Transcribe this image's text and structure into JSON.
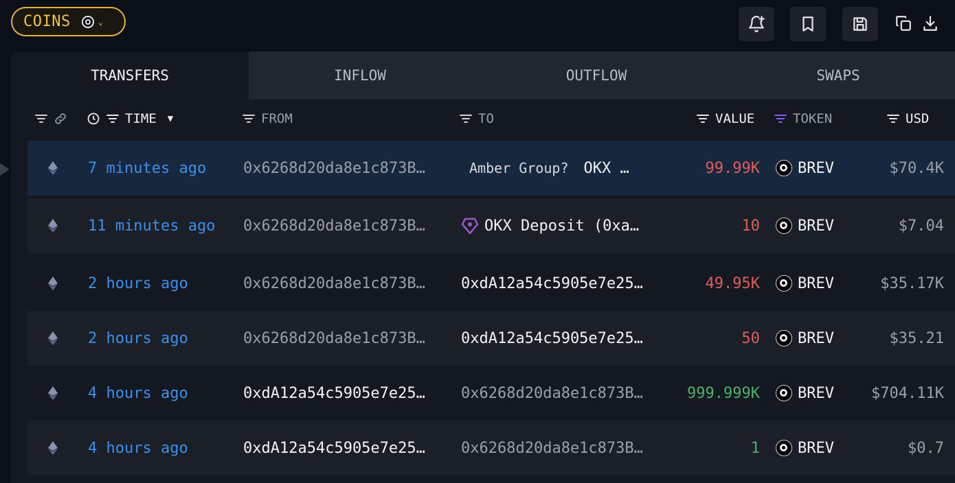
{
  "toolbar": {
    "coins_label": "COINS",
    "coins_token_icon": "token-icon",
    "buttons": [
      {
        "name": "add-alert-button",
        "icon": "bell-plus-icon"
      },
      {
        "name": "bookmark-button",
        "icon": "bookmark-icon"
      },
      {
        "name": "save-button",
        "icon": "save-icon"
      },
      {
        "name": "copy-button",
        "icon": "copy-icon"
      },
      {
        "name": "download-button",
        "icon": "download-icon"
      }
    ]
  },
  "tabs": [
    {
      "label": "TRANSFERS",
      "active": true
    },
    {
      "label": "INFLOW",
      "active": false
    },
    {
      "label": "OUTFLOW",
      "active": false
    },
    {
      "label": "SWAPS",
      "active": false
    }
  ],
  "columns": {
    "time": "TIME",
    "from": "FROM",
    "to": "TO",
    "value": "VALUE",
    "token": "TOKEN",
    "usd": "USD"
  },
  "rows": [
    {
      "chain": "ethereum-icon",
      "time": "7 minutes ago",
      "from": "0x6268d20da8e1c873B…",
      "to_entity_small": "Amber Group?",
      "to": "OKX …",
      "value": "99.99K",
      "direction": "out",
      "token": "BREV",
      "usd": "$70.4K",
      "selected": true
    },
    {
      "chain": "ethereum-icon",
      "time": "11 minutes ago",
      "from": "0x6268d20da8e1c873B…",
      "to_icon": "okx-icon",
      "to": "OKX Deposit (0xa…",
      "value": "10",
      "direction": "out",
      "token": "BREV",
      "usd": "$7.04"
    },
    {
      "chain": "ethereum-icon",
      "time": "2 hours ago",
      "from": "0x6268d20da8e1c873B…",
      "to": "0xdA12a54c5905e7e25…",
      "value": "49.95K",
      "direction": "out",
      "token": "BREV",
      "usd": "$35.17K"
    },
    {
      "chain": "ethereum-icon",
      "time": "2 hours ago",
      "from": "0x6268d20da8e1c873B…",
      "to": "0xdA12a54c5905e7e25…",
      "value": "50",
      "direction": "out",
      "token": "BREV",
      "usd": "$35.21"
    },
    {
      "chain": "ethereum-icon",
      "time": "4 hours ago",
      "from": "0xdA12a54c5905e7e25…",
      "to": "0x6268d20da8e1c873B…",
      "value": "999.999K",
      "direction": "in",
      "token": "BREV",
      "usd": "$704.11K"
    },
    {
      "chain": "ethereum-icon",
      "time": "4 hours ago",
      "from": "0xdA12a54c5905e7e25…",
      "to": "0x6268d20da8e1c873B…",
      "value": "1",
      "direction": "in",
      "token": "BREV",
      "usd": "$0.7"
    }
  ],
  "colors": {
    "accent": "#e2b33a",
    "link": "#3d8fea",
    "negative": "#e25c5c",
    "positive": "#4caf6a",
    "token_filter": "#8a5cf6"
  }
}
